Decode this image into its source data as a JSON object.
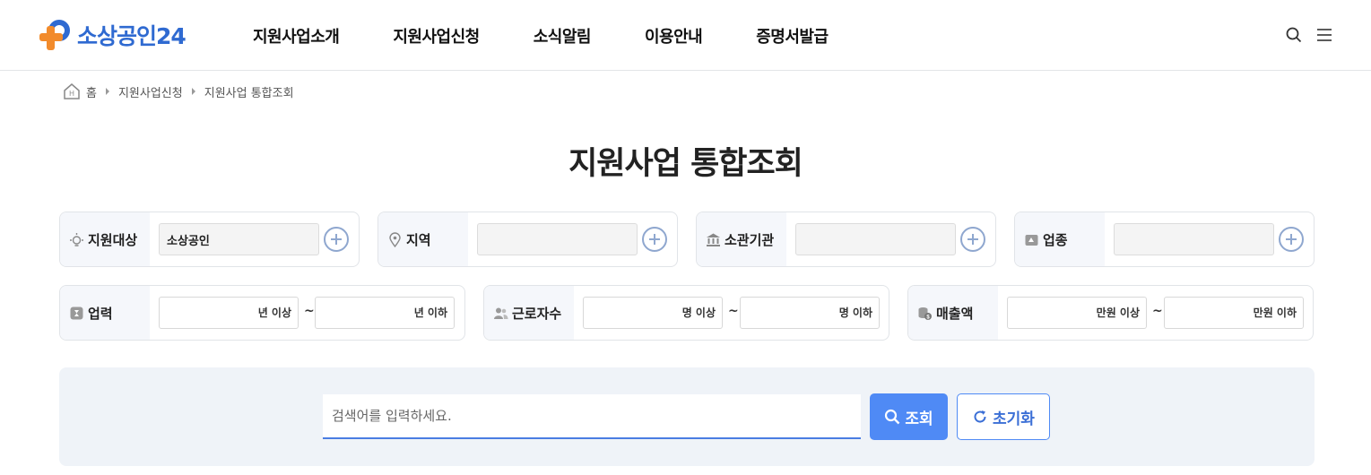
{
  "header": {
    "logo_text": "소상공인24",
    "nav": [
      "지원사업소개",
      "지원사업신청",
      "소식알림",
      "이용안내",
      "증명서발급"
    ]
  },
  "breadcrumb": [
    "홈",
    "지원사업신청",
    "지원사업 통합조회"
  ],
  "page_title": "지원사업 통합조회",
  "filters": {
    "target": {
      "label": "지원대상",
      "value": "소상공인"
    },
    "region": {
      "label": "지역",
      "value": ""
    },
    "agency": {
      "label": "소관기관",
      "value": ""
    },
    "industry": {
      "label": "업종",
      "value": ""
    },
    "business_years": {
      "label": "업력",
      "min_suffix": "년 이상",
      "max_suffix": "년 이하"
    },
    "employees": {
      "label": "근로자수",
      "min_suffix": "명 이상",
      "max_suffix": "명 이하"
    },
    "sales": {
      "label": "매출액",
      "min_suffix": "만원 이상",
      "max_suffix": "만원 이하"
    },
    "range_sep": "~"
  },
  "search": {
    "placeholder": "검색어를 입력하세요.",
    "search_label": "조회",
    "reset_label": "초기화"
  },
  "colors": {
    "brand_blue": "#2f6ad1",
    "brand_orange": "#f28b2c",
    "button_blue": "#4f8af5"
  }
}
